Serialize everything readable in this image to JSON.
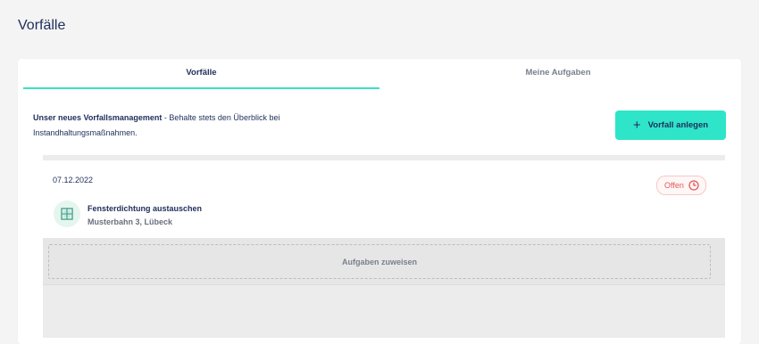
{
  "page": {
    "title": "Vorfälle"
  },
  "tabs": [
    {
      "label": "Vorfälle",
      "active": true
    },
    {
      "label": "Meine Aufgaben",
      "active": false
    }
  ],
  "intro": {
    "bold": "Unser neues Vorfallsmanagement",
    "text": " - Behalte stets den Überblick bei Instandhaltungsmaßnahmen."
  },
  "create_button": {
    "icon": "plus-icon",
    "label": "Vorfall anlegen"
  },
  "incidents": [
    {
      "date": "07.12.2022",
      "status": "Offen",
      "status_icon": "clock-icon",
      "icon": "window-icon",
      "title": "Fensterdichtung austauschen",
      "address": "Musterbahn 3, Lübeck",
      "assign_label": "Aufgaben zuweisen"
    }
  ],
  "colors": {
    "accent": "#2ee5c9",
    "text": "#1f2d5a",
    "status_open": "#e05a5a",
    "icon_bg": "#e4f6ee"
  }
}
